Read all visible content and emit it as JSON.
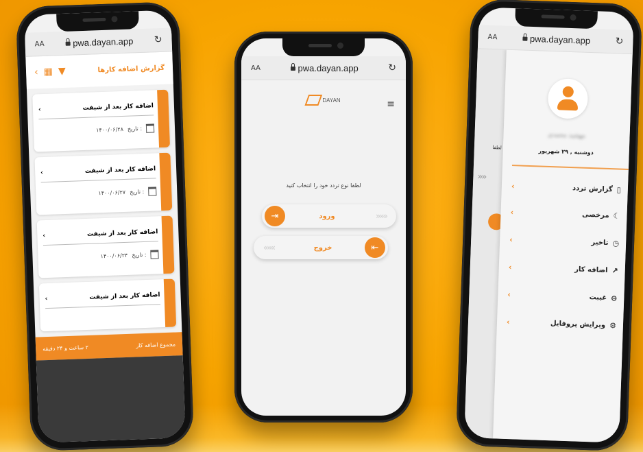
{
  "browser": {
    "aa_label": "AA",
    "url": "pwa.dayan.app",
    "reload_icon": "reload-icon"
  },
  "left_screen": {
    "title": "گزارش اضافه کارها",
    "cards": [
      {
        "title": "اضافه کار بعد از شیفت",
        "date_label": "تاریخ :",
        "date": "۱۴۰۰/۰۶/۲۸"
      },
      {
        "title": "اضافه کار بعد از شیفت",
        "date_label": "تاریخ :",
        "date": "۱۴۰۰/۰۶/۲۷"
      },
      {
        "title": "اضافه کار بعد از شیفت",
        "date_label": "تاریخ :",
        "date": "۱۴۰۰/۰۶/۲۴"
      },
      {
        "title": "اضافه کار بعد از شیفت",
        "date_label": "",
        "date": ""
      }
    ],
    "footer_label": "مجموع اضافه کار",
    "footer_value": "۲ ساعت و ۲۴ دقیقه"
  },
  "mid_screen": {
    "logo_text": "DAYAN",
    "prompt": "لطفا نوع تردد خود را انتخاب کنید",
    "enter_label": "ورود",
    "exit_label": "خروج"
  },
  "right_screen": {
    "peek_label": "لطفا",
    "user_name": "مهشید محمدی",
    "date": "دوشنبه , ۲۹ شهریور",
    "menu": [
      {
        "label": "گزارش تردد",
        "icon": "clipboard-icon"
      },
      {
        "label": "مرخصی",
        "icon": "moon-icon"
      },
      {
        "label": "تاخیر",
        "icon": "clock-icon"
      },
      {
        "label": "اضافه کار",
        "icon": "trend-icon"
      },
      {
        "label": "غیبت",
        "icon": "minus-circle-icon"
      },
      {
        "label": "ویرایش پروفایل",
        "icon": "gear-icon"
      }
    ]
  },
  "colors": {
    "accent": "#f08a24",
    "background": "#f7a400"
  }
}
